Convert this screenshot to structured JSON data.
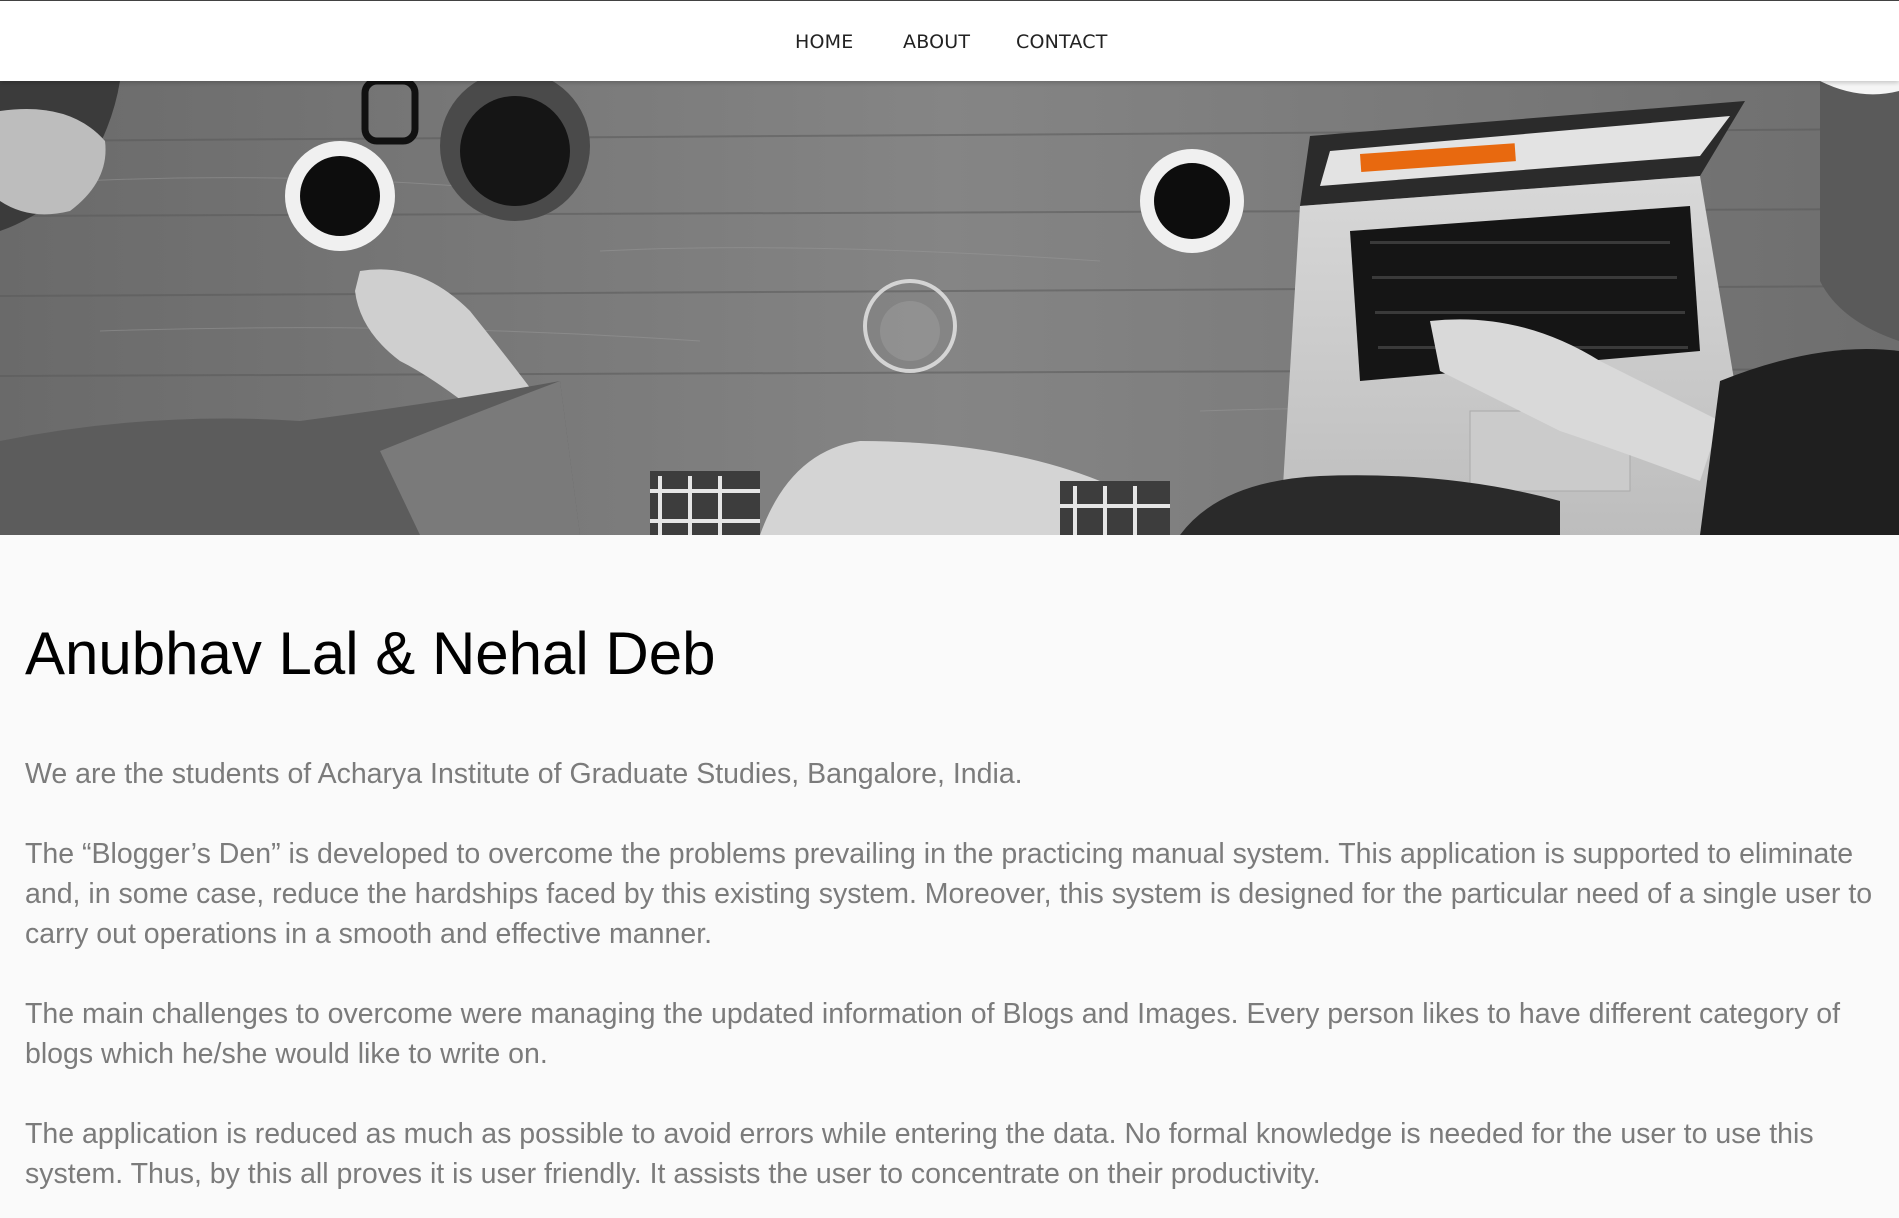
{
  "nav": {
    "items": [
      {
        "label": "HOME"
      },
      {
        "label": "ABOUT"
      },
      {
        "label": "CONTACT"
      }
    ]
  },
  "hero": {
    "description_icon": "hero-office-desk-image",
    "accent_color": "#e8690f"
  },
  "main": {
    "title": "Anubhav Lal & Nehal Deb",
    "paragraphs": [
      "We are the students of Acharya Institute of Graduate Studies, Bangalore, India.",
      "The “Blogger’s Den” is developed to overcome the problems prevailing in the practicing manual system. This application is supported to eliminate and, in some case, reduce the hardships faced by this existing system. Moreover, this system is designed for the particular need of a single user to carry out operations in a smooth and effective manner.",
      "The main challenges to overcome were managing the updated information of Blogs and Images. Every person likes to have different category of blogs which he/she would like to write on.",
      "The application is reduced as much as possible to avoid errors while entering the data. No formal knowledge is needed for the user to use this system. Thus, by this all proves it is user friendly. It assists the user to concentrate on their productivity."
    ]
  },
  "colors": {
    "text_body": "#7b7b7b",
    "title": "#000000",
    "nav_bg": "#ffffff"
  }
}
